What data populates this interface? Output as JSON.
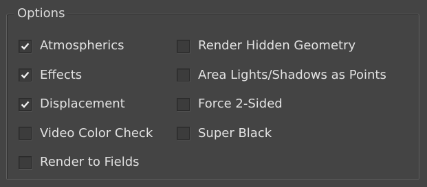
{
  "group": {
    "title": "Options"
  },
  "left_column": [
    {
      "label": "Atmospherics",
      "checked": true
    },
    {
      "label": "Effects",
      "checked": true
    },
    {
      "label": "Displacement",
      "checked": true
    },
    {
      "label": "Video Color Check",
      "checked": false
    },
    {
      "label": "Render to Fields",
      "checked": false
    }
  ],
  "right_column": [
    {
      "label": "Render Hidden Geometry",
      "checked": false
    },
    {
      "label": "Area Lights/Shadows as Points",
      "checked": false
    },
    {
      "label": "Force 2-Sided",
      "checked": false
    },
    {
      "label": "Super Black",
      "checked": false
    }
  ],
  "colors": {
    "background": "#444444",
    "text": "#e2e2e2",
    "checkmark": "#f0f0f0"
  }
}
